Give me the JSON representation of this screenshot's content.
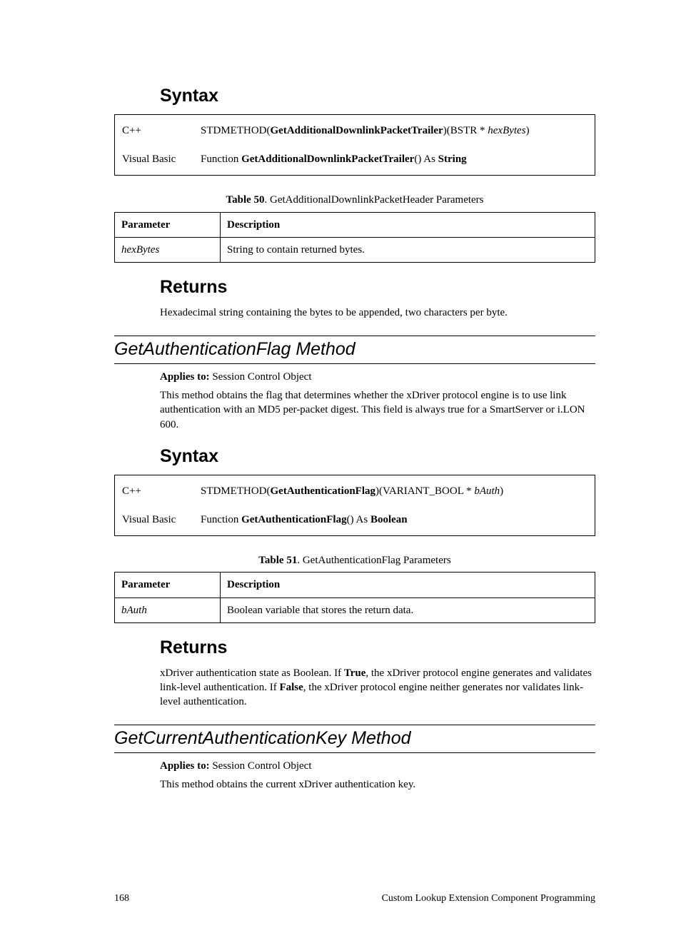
{
  "section1": {
    "syntax_heading": "Syntax",
    "syntax_rows": [
      {
        "lang": "C++",
        "parts": [
          "STDMETHOD(",
          "GetAdditionalDownlinkPacketTrailer",
          ")(BSTR * ",
          "hexBytes",
          ")"
        ]
      },
      {
        "lang": "Visual Basic",
        "parts": [
          "Function ",
          "GetAdditionalDownlinkPacketTrailer",
          "() As ",
          "String",
          ""
        ]
      }
    ],
    "table_caption_label": "Table 50",
    "table_caption_text": ". GetAdditionalDownlinkPacketHeader Parameters",
    "param_header": [
      "Parameter",
      "Description"
    ],
    "param_rows": [
      {
        "name": "hexBytes",
        "desc": "String to contain returned bytes."
      }
    ],
    "returns_heading": "Returns",
    "returns_text": "Hexadecimal string containing the bytes to be appended, two characters per byte."
  },
  "method2": {
    "title": "GetAuthenticationFlag Method",
    "applies_label": "Applies to:",
    "applies_value": "  Session Control Object",
    "desc": "This method obtains the flag that determines whether the xDriver protocol engine is to use link authentication with an MD5 per-packet digest.  This field is always true for a SmartServer or i.LON 600.",
    "syntax_heading": "Syntax",
    "syntax_rows": [
      {
        "lang": "C++",
        "parts": [
          "STDMETHOD(",
          "GetAuthenticationFlag",
          ")(VARIANT_BOOL * ",
          "bAuth",
          ")"
        ]
      },
      {
        "lang": "Visual Basic",
        "parts": [
          "Function ",
          "GetAuthenticationFlag",
          "() As ",
          "Boolean",
          ""
        ]
      }
    ],
    "table_caption_label": "Table 51",
    "table_caption_text": ". GetAuthenticationFlag Parameters",
    "param_header": [
      "Parameter",
      "Description"
    ],
    "param_rows": [
      {
        "name": "bAuth",
        "desc": "Boolean variable that stores the return data."
      }
    ],
    "returns_heading": "Returns",
    "returns_parts": [
      "xDriver authentication state as Boolean.  If ",
      "True",
      ", the xDriver protocol engine generates and validates link-level authentication.  If ",
      "False",
      ", the xDriver protocol engine neither generates nor validates link-level authentication."
    ]
  },
  "method3": {
    "title": "GetCurrentAuthenticationKey Method",
    "applies_label": "Applies to:",
    "applies_value": "  Session Control Object",
    "desc": "This method obtains the current xDriver authentication key."
  },
  "footer": {
    "page": "168",
    "title": "Custom Lookup Extension Component Programming"
  }
}
